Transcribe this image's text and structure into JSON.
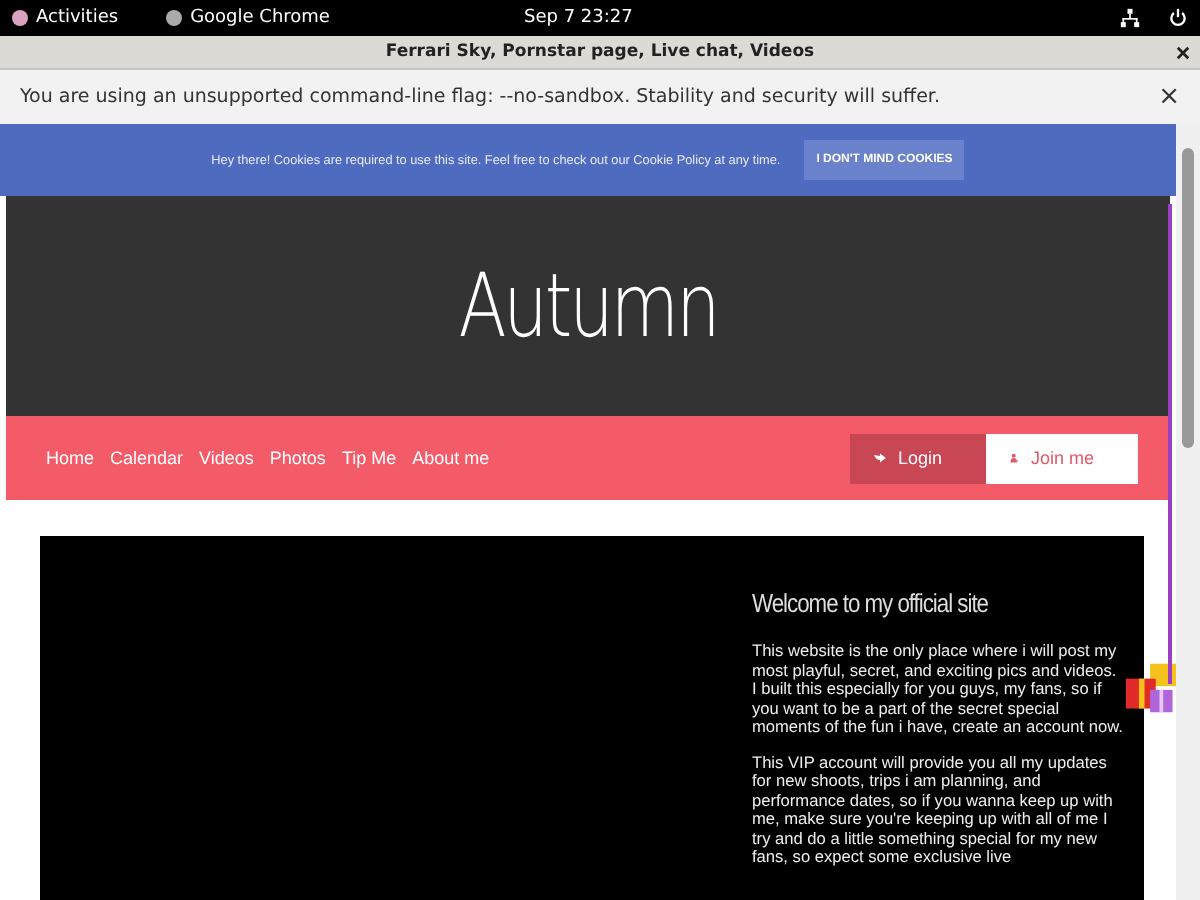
{
  "top_bar": {
    "activities": "Activities",
    "app": "Google Chrome",
    "clock": "Sep 7  23:27"
  },
  "window": {
    "title": "Ferrari Sky, Pornstar page, Live chat, Videos"
  },
  "info_bar": {
    "message": "You are using an unsupported command-line flag: --no-sandbox. Stability and security will suffer.",
    "close": "×"
  },
  "cookie_banner": {
    "message": "Hey there! Cookies are required to use this site. Feel free to check out our Cookie Policy at any time.",
    "button": "I DON'T MIND COOKIES"
  },
  "header": {
    "title": "Autumn"
  },
  "nav": {
    "items": [
      "Home",
      "Calendar",
      "Videos",
      "Photos",
      "Tip Me",
      "About me"
    ],
    "login": "Login",
    "join": "Join me"
  },
  "content": {
    "heading": "Welcome to my official site",
    "paragraphs": [
      "This website is the only place where i will post my most playful, secret, and exciting pics and videos. I built this especially for you guys, my fans, so if you want to be a part of the secret special moments of the fun i have, create an account now.",
      "This VIP account will provide you all my updates for new shoots, trips i am planning, and performance dates, so if you wanna keep up with me, make sure you're keeping up with all of me I try and do a little something special for my new fans, so expect some exclusive live"
    ]
  }
}
